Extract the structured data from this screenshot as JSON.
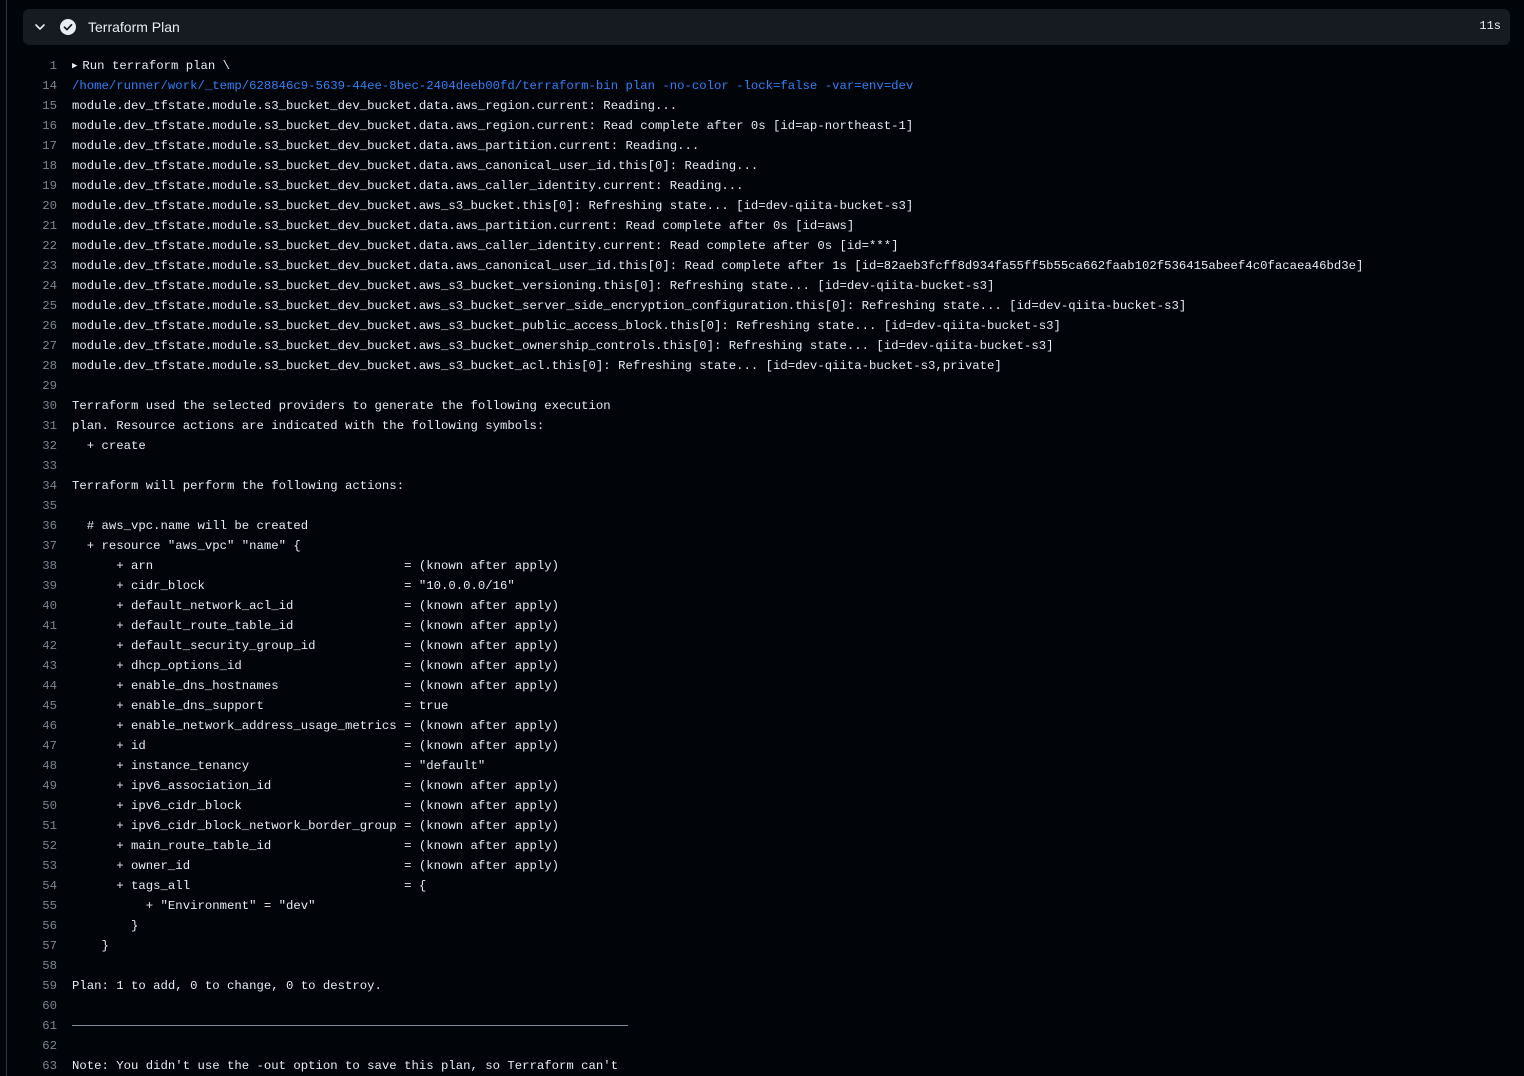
{
  "step": {
    "title": "Terraform Plan",
    "duration": "11s",
    "status": "success"
  },
  "lines": [
    {
      "num": "1",
      "text": "Run terraform plan \\",
      "kind": "group"
    },
    {
      "num": "14",
      "text": "/home/runner/work/_temp/628846c9-5639-44ee-8bec-2404deeb00fd/terraform-bin plan -no-color -lock=false -var=env=dev",
      "kind": "cmd"
    },
    {
      "num": "15",
      "text": "module.dev_tfstate.module.s3_bucket_dev_bucket.data.aws_region.current: Reading...",
      "kind": "text"
    },
    {
      "num": "16",
      "text": "module.dev_tfstate.module.s3_bucket_dev_bucket.data.aws_region.current: Read complete after 0s [id=ap-northeast-1]",
      "kind": "text"
    },
    {
      "num": "17",
      "text": "module.dev_tfstate.module.s3_bucket_dev_bucket.data.aws_partition.current: Reading...",
      "kind": "text"
    },
    {
      "num": "18",
      "text": "module.dev_tfstate.module.s3_bucket_dev_bucket.data.aws_canonical_user_id.this[0]: Reading...",
      "kind": "text"
    },
    {
      "num": "19",
      "text": "module.dev_tfstate.module.s3_bucket_dev_bucket.data.aws_caller_identity.current: Reading...",
      "kind": "text"
    },
    {
      "num": "20",
      "text": "module.dev_tfstate.module.s3_bucket_dev_bucket.aws_s3_bucket.this[0]: Refreshing state... [id=dev-qiita-bucket-s3]",
      "kind": "text"
    },
    {
      "num": "21",
      "text": "module.dev_tfstate.module.s3_bucket_dev_bucket.data.aws_partition.current: Read complete after 0s [id=aws]",
      "kind": "text"
    },
    {
      "num": "22",
      "text": "module.dev_tfstate.module.s3_bucket_dev_bucket.data.aws_caller_identity.current: Read complete after 0s [id=***]",
      "kind": "text"
    },
    {
      "num": "23",
      "text": "module.dev_tfstate.module.s3_bucket_dev_bucket.data.aws_canonical_user_id.this[0]: Read complete after 1s [id=82aeb3fcff8d934fa55ff5b55ca662faab102f536415abeef4c0facaea46bd3e]",
      "kind": "text"
    },
    {
      "num": "24",
      "text": "module.dev_tfstate.module.s3_bucket_dev_bucket.aws_s3_bucket_versioning.this[0]: Refreshing state... [id=dev-qiita-bucket-s3]",
      "kind": "text"
    },
    {
      "num": "25",
      "text": "module.dev_tfstate.module.s3_bucket_dev_bucket.aws_s3_bucket_server_side_encryption_configuration.this[0]: Refreshing state... [id=dev-qiita-bucket-s3]",
      "kind": "text"
    },
    {
      "num": "26",
      "text": "module.dev_tfstate.module.s3_bucket_dev_bucket.aws_s3_bucket_public_access_block.this[0]: Refreshing state... [id=dev-qiita-bucket-s3]",
      "kind": "text"
    },
    {
      "num": "27",
      "text": "module.dev_tfstate.module.s3_bucket_dev_bucket.aws_s3_bucket_ownership_controls.this[0]: Refreshing state... [id=dev-qiita-bucket-s3]",
      "kind": "text"
    },
    {
      "num": "28",
      "text": "module.dev_tfstate.module.s3_bucket_dev_bucket.aws_s3_bucket_acl.this[0]: Refreshing state... [id=dev-qiita-bucket-s3,private]",
      "kind": "text"
    },
    {
      "num": "29",
      "text": "",
      "kind": "text"
    },
    {
      "num": "30",
      "text": "Terraform used the selected providers to generate the following execution",
      "kind": "text"
    },
    {
      "num": "31",
      "text": "plan. Resource actions are indicated with the following symbols:",
      "kind": "text"
    },
    {
      "num": "32",
      "text": "  + create",
      "kind": "text"
    },
    {
      "num": "33",
      "text": "",
      "kind": "text"
    },
    {
      "num": "34",
      "text": "Terraform will perform the following actions:",
      "kind": "text"
    },
    {
      "num": "35",
      "text": "",
      "kind": "text"
    },
    {
      "num": "36",
      "text": "  # aws_vpc.name will be created",
      "kind": "text"
    },
    {
      "num": "37",
      "text": "  + resource \"aws_vpc\" \"name\" {",
      "kind": "text"
    },
    {
      "num": "38",
      "text": "      + arn                                  = (known after apply)",
      "kind": "text"
    },
    {
      "num": "39",
      "text": "      + cidr_block                           = \"10.0.0.0/16\"",
      "kind": "text"
    },
    {
      "num": "40",
      "text": "      + default_network_acl_id               = (known after apply)",
      "kind": "text"
    },
    {
      "num": "41",
      "text": "      + default_route_table_id               = (known after apply)",
      "kind": "text"
    },
    {
      "num": "42",
      "text": "      + default_security_group_id            = (known after apply)",
      "kind": "text"
    },
    {
      "num": "43",
      "text": "      + dhcp_options_id                      = (known after apply)",
      "kind": "text"
    },
    {
      "num": "44",
      "text": "      + enable_dns_hostnames                 = (known after apply)",
      "kind": "text"
    },
    {
      "num": "45",
      "text": "      + enable_dns_support                   = true",
      "kind": "text"
    },
    {
      "num": "46",
      "text": "      + enable_network_address_usage_metrics = (known after apply)",
      "kind": "text"
    },
    {
      "num": "47",
      "text": "      + id                                   = (known after apply)",
      "kind": "text"
    },
    {
      "num": "48",
      "text": "      + instance_tenancy                     = \"default\"",
      "kind": "text"
    },
    {
      "num": "49",
      "text": "      + ipv6_association_id                  = (known after apply)",
      "kind": "text"
    },
    {
      "num": "50",
      "text": "      + ipv6_cidr_block                      = (known after apply)",
      "kind": "text"
    },
    {
      "num": "51",
      "text": "      + ipv6_cidr_block_network_border_group = (known after apply)",
      "kind": "text"
    },
    {
      "num": "52",
      "text": "      + main_route_table_id                  = (known after apply)",
      "kind": "text"
    },
    {
      "num": "53",
      "text": "      + owner_id                             = (known after apply)",
      "kind": "text"
    },
    {
      "num": "54",
      "text": "      + tags_all                             = {",
      "kind": "text"
    },
    {
      "num": "55",
      "text": "          + \"Environment\" = \"dev\"",
      "kind": "text"
    },
    {
      "num": "56",
      "text": "        }",
      "kind": "text"
    },
    {
      "num": "57",
      "text": "    }",
      "kind": "text"
    },
    {
      "num": "58",
      "text": "",
      "kind": "text"
    },
    {
      "num": "59",
      "text": "Plan: 1 to add, 0 to change, 0 to destroy.",
      "kind": "text"
    },
    {
      "num": "60",
      "text": "",
      "kind": "text"
    },
    {
      "num": "61",
      "text": "",
      "kind": "separator"
    },
    {
      "num": "62",
      "text": "",
      "kind": "text"
    },
    {
      "num": "63",
      "text": "Note: You didn't use the -out option to save this plan, so Terraform can't",
      "kind": "text"
    }
  ]
}
